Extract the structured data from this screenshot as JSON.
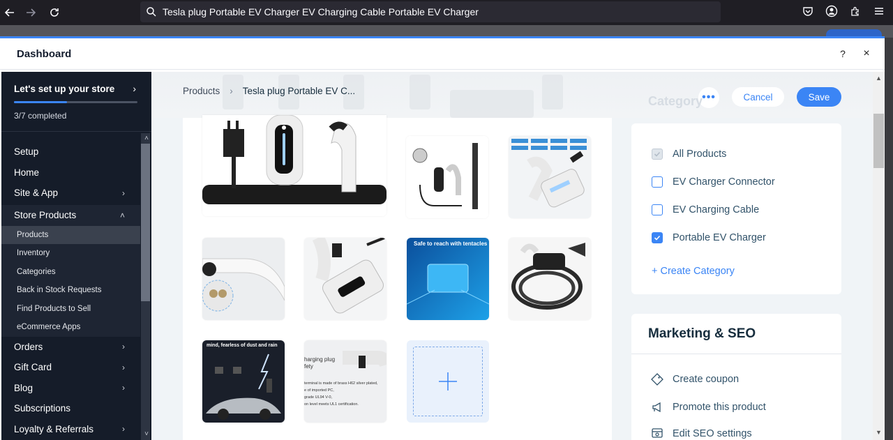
{
  "browser": {
    "url_text": "Tesla plug Portable EV Charger EV Charging Cable Portable EV Charger"
  },
  "modal": {
    "title": "Dashboard",
    "help_label": "?",
    "close_label": "×"
  },
  "sidebar": {
    "setup": {
      "title": "Let's set up your store",
      "progress_text": "3/7 completed",
      "progress_fraction": 0.4286
    },
    "items": [
      {
        "label": "Setup",
        "has_chevron": false
      },
      {
        "label": "Home",
        "has_chevron": false
      },
      {
        "label": "Site & App",
        "has_chevron": true
      }
    ],
    "group": {
      "label": "Store Products",
      "sub_items": [
        {
          "label": "Products",
          "active": true
        },
        {
          "label": "Inventory",
          "active": false
        },
        {
          "label": "Categories",
          "active": false
        },
        {
          "label": "Back in Stock Requests",
          "active": false
        },
        {
          "label": "Find Products to Sell",
          "active": false
        },
        {
          "label": "eCommerce Apps",
          "active": false
        }
      ]
    },
    "items_after": [
      {
        "label": "Orders",
        "has_chevron": true
      },
      {
        "label": "Gift Card",
        "has_chevron": true
      },
      {
        "label": "Blog",
        "has_chevron": true
      },
      {
        "label": "Subscriptions",
        "has_chevron": false
      },
      {
        "label": "Loyalty & Referrals",
        "has_chevron": true
      }
    ]
  },
  "main": {
    "breadcrumb": {
      "root": "Products",
      "current": "Tesla plug Portable EV C..."
    },
    "actions": {
      "more_label": "•••",
      "cancel_label": "Cancel",
      "save_label": "Save"
    },
    "gallery_overlay_texts": {
      "thumb_blue": "Safe to reach with tentacles",
      "thumb_rain": "mind, fearless of dust and rain",
      "thumb_text_1": "harging plug",
      "thumb_text_2": "fety",
      "thumb_text_3": "terminal is made of brass H62 silver plated,",
      "thumb_text_4": "e of imported PC,",
      "thumb_text_5": "grade UL94 V-0,",
      "thumb_text_6": "on level meets UL1 certification."
    },
    "categories": {
      "ghost_title": "Category",
      "options": [
        {
          "label": "All Products",
          "checked": true,
          "disabled": true
        },
        {
          "label": "EV Charger Connector",
          "checked": false,
          "disabled": false
        },
        {
          "label": "EV Charging Cable",
          "checked": false,
          "disabled": false
        },
        {
          "label": "Portable EV Charger",
          "checked": true,
          "disabled": false
        }
      ],
      "create_label": "+ Create Category"
    },
    "marketing": {
      "title": "Marketing & SEO",
      "rows": [
        {
          "label": "Create coupon",
          "icon": "coupon-icon"
        },
        {
          "label": "Promote this product",
          "icon": "megaphone-icon"
        },
        {
          "label": "Edit SEO settings",
          "icon": "seo-settings-icon"
        }
      ]
    }
  },
  "colors": {
    "accent": "#3b85f5",
    "sidebar_bg": "#151c29",
    "browser_bg": "#1f1e24"
  }
}
